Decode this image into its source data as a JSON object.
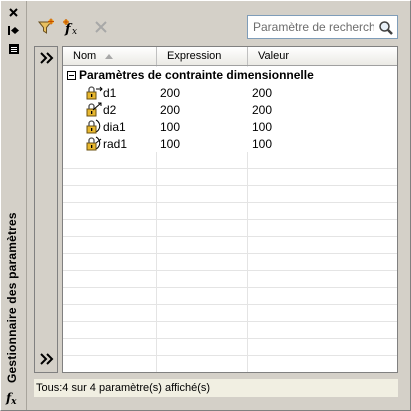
{
  "palette": {
    "title": "Gestionnaire des paramètres",
    "title_icon": "fx-icon"
  },
  "strip_buttons": [
    "close-icon",
    "auto-hide-icon",
    "properties-icon"
  ],
  "toolbar": {
    "buttons": [
      "filter-icon",
      "new-user-parameter-icon",
      "delete-parameter-icon"
    ],
    "search_placeholder": "Paramètre de recherche",
    "search_value": ""
  },
  "filter_pane": {
    "expand_label": "»",
    "collapse_label": "»"
  },
  "grid": {
    "columns": [
      "Nom",
      "Expression",
      "Valeur"
    ],
    "group": {
      "label": "Paramètres de contrainte dimensionnelle",
      "expanded": true
    },
    "rows": [
      {
        "name": "d1",
        "expression": "200",
        "value": "200",
        "icon": "linear-constraint-lock-icon"
      },
      {
        "name": "d2",
        "expression": "200",
        "value": "200",
        "icon": "aligned-constraint-lock-icon"
      },
      {
        "name": "dia1",
        "expression": "100",
        "value": "100",
        "icon": "diameter-constraint-lock-icon"
      },
      {
        "name": "rad1",
        "expression": "100",
        "value": "100",
        "icon": "radius-constraint-lock-icon"
      }
    ]
  },
  "status": {
    "text": "Tous:4 sur 4 paramètre(s) affiché(s)"
  }
}
